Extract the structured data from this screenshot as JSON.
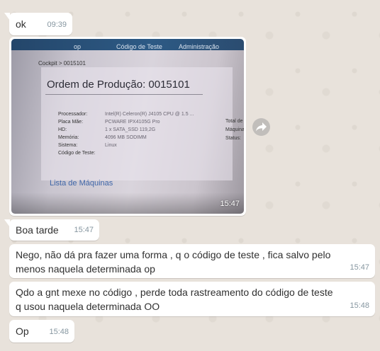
{
  "messages": [
    {
      "text": "ok",
      "time": "09:39"
    },
    {
      "text": "Boa tarde",
      "time": "15:47"
    },
    {
      "text": "Nego, não dá pra fazer uma forma , q o código de teste , fica salvo pelo menos naquela determinada op",
      "time": "15:47"
    },
    {
      "text": "Qdo a gnt mexe no código , perde toda rastreamento do código de teste q usou naquela determinada OO",
      "time": "15:48"
    },
    {
      "text": "Op",
      "time": "15:48"
    }
  ],
  "photo": {
    "time": "15:47",
    "screen": {
      "tab_1": "op",
      "tab_2": "Código de Teste",
      "tab_3": "Administração",
      "breadcrumb": "Cockpit > 0015101",
      "title": "Ordem de Produção: 0015101",
      "specs": [
        {
          "label": "Processador:",
          "value": "Intel(R) Celeron(R) J4105 CPU @ 1.5 ..."
        },
        {
          "label": "Placa Mãe:",
          "value": "PCWARE IPX4105G Pro"
        },
        {
          "label": "HD:",
          "value": "1 x SATA_SSD 119,2G"
        },
        {
          "label": "Memória:",
          "value": "4096 MB SODIMM"
        },
        {
          "label": "Sistema:",
          "value": "Linux"
        },
        {
          "label": "Código de Teste:",
          "value": ""
        }
      ],
      "side_1": "Total de",
      "side_2": "Máquinas",
      "side_3": "Status:",
      "link": "Lista de Máquinas"
    }
  },
  "icons": {
    "forward": "forward-arrow-icon"
  }
}
